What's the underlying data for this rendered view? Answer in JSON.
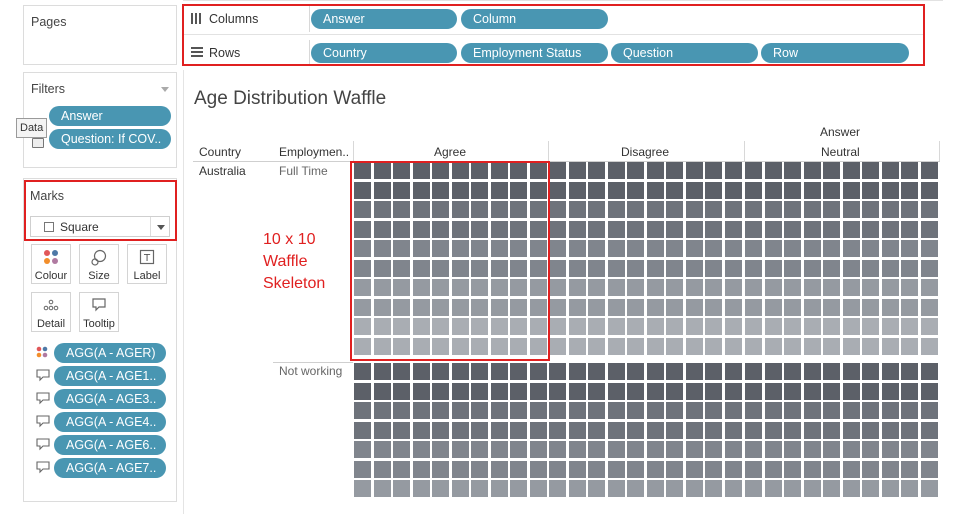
{
  "pages": {
    "title": "Pages"
  },
  "shelves": {
    "columns": {
      "label": "Columns",
      "pills": [
        "Answer",
        "Column"
      ]
    },
    "rows": {
      "label": "Rows",
      "pills": [
        "Country",
        "Employment Status",
        "Question",
        "Row"
      ]
    }
  },
  "filters": {
    "title": "Filters",
    "pills": [
      "Answer",
      "Question: If COV.."
    ],
    "tooltip": "Data"
  },
  "marks": {
    "title": "Marks",
    "type": "Square",
    "buttons": [
      {
        "label": "Colour",
        "icon": "colour-dots-icon"
      },
      {
        "label": "Size",
        "icon": "size-icon"
      },
      {
        "label": "Label",
        "icon": "label-icon"
      },
      {
        "label": "Detail",
        "icon": "detail-dots-icon"
      },
      {
        "label": "Tooltip",
        "icon": "tooltip-icon"
      }
    ],
    "fields": [
      {
        "label": "AGG(A - AGER)",
        "icon": "colour-dots-icon"
      },
      {
        "label": "AGG(A - AGE1..",
        "icon": "tooltip-icon"
      },
      {
        "label": "AGG(A - AGE3..",
        "icon": "tooltip-icon"
      },
      {
        "label": "AGG(A - AGE4..",
        "icon": "tooltip-icon"
      },
      {
        "label": "AGG(A - AGE6..",
        "icon": "tooltip-icon"
      },
      {
        "label": "AGG(A - AGE7..",
        "icon": "tooltip-icon"
      }
    ]
  },
  "view": {
    "title": "Age Distribution Waffle",
    "column_header_title": "Answer",
    "row_headers": [
      "Country",
      "Employmen.."
    ],
    "answers": [
      "Agree",
      "Disagree",
      "Neutral"
    ],
    "country": "Australia",
    "employment_statuses": [
      "Full Time",
      "Not working"
    ],
    "annotation": [
      "10 x 10",
      "Waffle",
      "Skeleton"
    ]
  },
  "colors": {
    "pill": "#4996b2",
    "highlight_red": "#e02020",
    "annotation_red": "#e02020",
    "waffle_shades": [
      "#5c6068",
      "#6e737b",
      "#80858d",
      "#959aa1",
      "#a9adb3"
    ]
  }
}
